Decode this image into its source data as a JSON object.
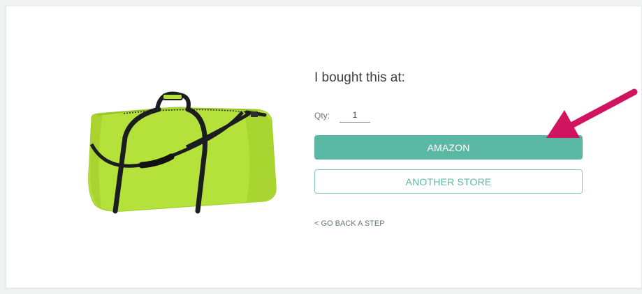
{
  "purchase": {
    "heading": "I bought this at:",
    "qty_label": "Qty:",
    "qty_value": "1",
    "buttons": {
      "primary_label": "AMAZON",
      "secondary_label": "ANOTHER STORE"
    },
    "back_link": "< GO BACK A STEP"
  },
  "product": {
    "image_icon": "duffel-bag-image",
    "bag_color": "#b5e23a",
    "strap_color": "#1b1d1f"
  },
  "annotation": {
    "icon": "arrow-pointer-icon",
    "color": "#d1145f"
  },
  "colors": {
    "accent": "#5bb8a4"
  }
}
